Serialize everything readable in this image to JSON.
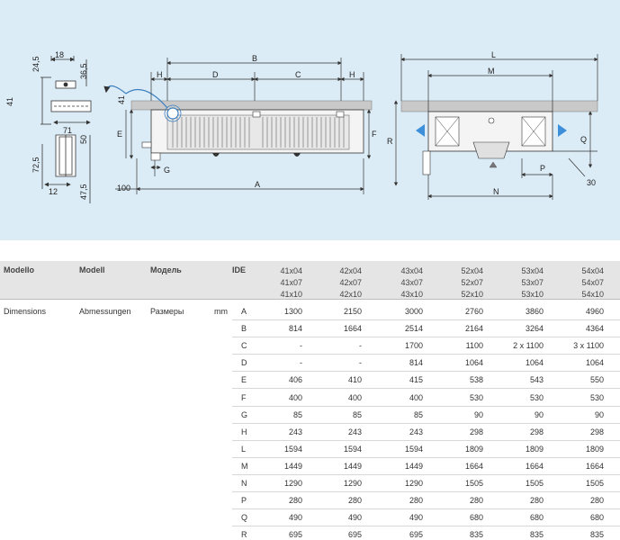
{
  "drawing": {
    "labels": {
      "b": "B",
      "d": "D",
      "c": "C",
      "h_left": "H",
      "h_right": "H",
      "e": "E",
      "f": "F",
      "g": "G",
      "a": "A",
      "val_100": "100",
      "val_41_mid": "41",
      "l": "L",
      "m": "M",
      "n": "N",
      "p": "P",
      "q": "Q",
      "r": "R",
      "val_30": "30",
      "val_18": "18",
      "val_24_5": "24,5",
      "val_36_5": "36,5",
      "val_41_side": "41",
      "val_71": "71",
      "val_50": "50",
      "val_72_5": "72,5",
      "val_12": "12",
      "val_47_5": "47,5"
    }
  },
  "table": {
    "header": {
      "modello": "Modello",
      "modell": "Modell",
      "model_ru": "Модель",
      "ide": "IDE",
      "columns": [
        {
          "line1": "41x04",
          "line2": "41x07",
          "line3": "41x10"
        },
        {
          "line1": "42x04",
          "line2": "42x07",
          "line3": "42x10"
        },
        {
          "line1": "43x04",
          "line2": "43x07",
          "line3": "43x10"
        },
        {
          "line1": "52x04",
          "line2": "52x07",
          "line3": "52x10"
        },
        {
          "line1": "53x04",
          "line2": "53x07",
          "line3": "53x10"
        },
        {
          "line1": "54x04",
          "line2": "54x07",
          "line3": "54x10"
        }
      ]
    },
    "section": {
      "dimensions": "Dimensions",
      "abmessungen": "Abmessungen",
      "razmery": "Размеры",
      "unit": "mm"
    },
    "rows": [
      {
        "letter": "A",
        "values": [
          "1300",
          "2150",
          "3000",
          "2760",
          "3860",
          "4960"
        ]
      },
      {
        "letter": "B",
        "values": [
          "814",
          "1664",
          "2514",
          "2164",
          "3264",
          "4364"
        ]
      },
      {
        "letter": "C",
        "values": [
          "-",
          "-",
          "1700",
          "1100",
          "2 x 1100",
          "3 x 1100"
        ]
      },
      {
        "letter": "D",
        "values": [
          "-",
          "-",
          "814",
          "1064",
          "1064",
          "1064"
        ]
      },
      {
        "letter": "E",
        "values": [
          "406",
          "410",
          "415",
          "538",
          "543",
          "550"
        ]
      },
      {
        "letter": "F",
        "values": [
          "400",
          "400",
          "400",
          "530",
          "530",
          "530"
        ]
      },
      {
        "letter": "G",
        "values": [
          "85",
          "85",
          "85",
          "90",
          "90",
          "90"
        ]
      },
      {
        "letter": "H",
        "values": [
          "243",
          "243",
          "243",
          "298",
          "298",
          "298"
        ]
      },
      {
        "letter": "L",
        "values": [
          "1594",
          "1594",
          "1594",
          "1809",
          "1809",
          "1809"
        ]
      },
      {
        "letter": "M",
        "values": [
          "1449",
          "1449",
          "1449",
          "1664",
          "1664",
          "1664"
        ]
      },
      {
        "letter": "N",
        "values": [
          "1290",
          "1290",
          "1290",
          "1505",
          "1505",
          "1505"
        ]
      },
      {
        "letter": "P",
        "values": [
          "280",
          "280",
          "280",
          "280",
          "280",
          "280"
        ]
      },
      {
        "letter": "Q",
        "values": [
          "490",
          "490",
          "490",
          "680",
          "680",
          "680"
        ]
      },
      {
        "letter": "R",
        "values": [
          "695",
          "695",
          "695",
          "835",
          "835",
          "835"
        ]
      }
    ]
  }
}
